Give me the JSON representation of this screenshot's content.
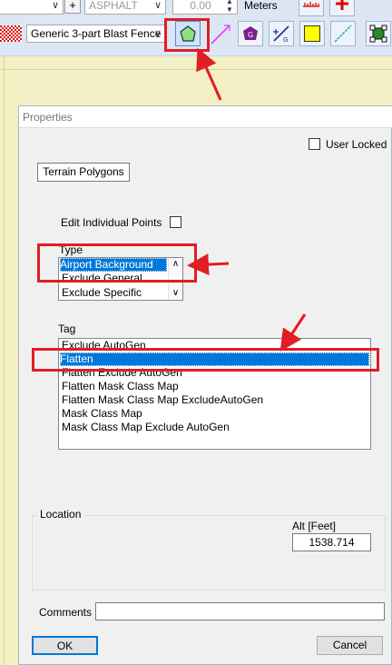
{
  "toolbar": {
    "surface_value": "ASPHALT",
    "value_field": "0.00",
    "units_label": "Meters",
    "plus_label": "+",
    "fence_type": "Generic 3-part Blast Fence",
    "colors": {
      "yellow": "#ffff00",
      "purple": "#7a1f8c",
      "accent_blue": "#0078d7"
    },
    "icons": [
      "plus-icon",
      "pattern-swatch-icon",
      "polygon-tool-icon",
      "line-tool-icon",
      "purple-polygon-g-icon",
      "runway-g-icon",
      "yellow-fill-icon",
      "diagonal-line-icon",
      "select-bounds-icon",
      "ruler-icon",
      "red-cross-icon"
    ]
  },
  "dialog": {
    "title": "Properties",
    "user_locked_label": "User Locked",
    "terrain_button": "Terrain Polygons",
    "edit_points_label": "Edit Individual Points",
    "type_label": "Type",
    "type_items": [
      "Airport Background",
      "Exclude General",
      "Exclude Specific"
    ],
    "tag_label": "Tag",
    "tag_items": [
      "Exclude AutoGen",
      "Flatten",
      "Flatten Exclude AutoGen",
      "Flatten Mask Class Map",
      "Flatten Mask Class Map ExcludeAutoGen",
      "Mask Class Map",
      "Mask Class Map Exclude AutoGen"
    ],
    "location_label": "Location",
    "alt_label": "Alt [Feet]",
    "alt_value": "1538.714",
    "comments_label": "Comments",
    "comments_value": "",
    "ok_label": "OK",
    "cancel_label": "Cancel"
  },
  "annotation_color": "#e21d24"
}
